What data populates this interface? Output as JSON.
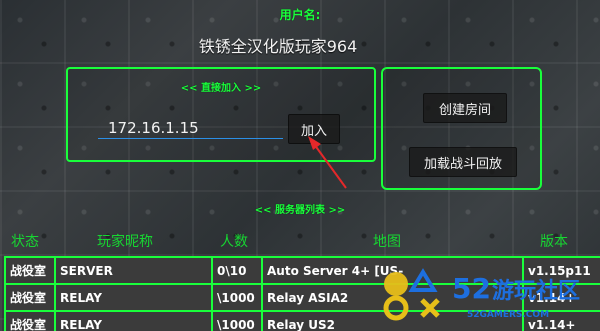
{
  "header": {
    "user_label": "用户名:",
    "player_name": "铁锈全汉化版玩家964"
  },
  "direct_join": {
    "title": "<< 直接加入 >>",
    "ip_value": "172.16.1.15",
    "join_label": "加入"
  },
  "actions": {
    "create_room_label": "创建房间",
    "load_battle_label": "加载战斗回放"
  },
  "server_list": {
    "title": "<< 服务器列表 >>",
    "columns": [
      "状态",
      "玩家昵称",
      "人数",
      "地图",
      "版本"
    ],
    "rows": [
      {
        "status": "战役室",
        "name": "SERVER",
        "count": "0\\10",
        "map": "Auto Server 4+ [US-",
        "version": "v1.15p11"
      },
      {
        "status": "战役室",
        "name": "RELAY",
        "count": "\\1000",
        "map": "Relay ASIA2",
        "version": "v1.14+"
      },
      {
        "status": "战役室",
        "name": "RELAY",
        "count": "\\1000",
        "map": "Relay US2",
        "version": "v1.14+"
      }
    ]
  },
  "watermark": {
    "number": "52",
    "text": "游玩社区",
    "sub": "52GAMERS.COM"
  },
  "colors": {
    "accent_green": "#19ff3b",
    "input_underline": "#2b8fe6",
    "annotation_arrow": "#e4282a"
  },
  "icons": [
    "annotation-arrow-icon"
  ]
}
